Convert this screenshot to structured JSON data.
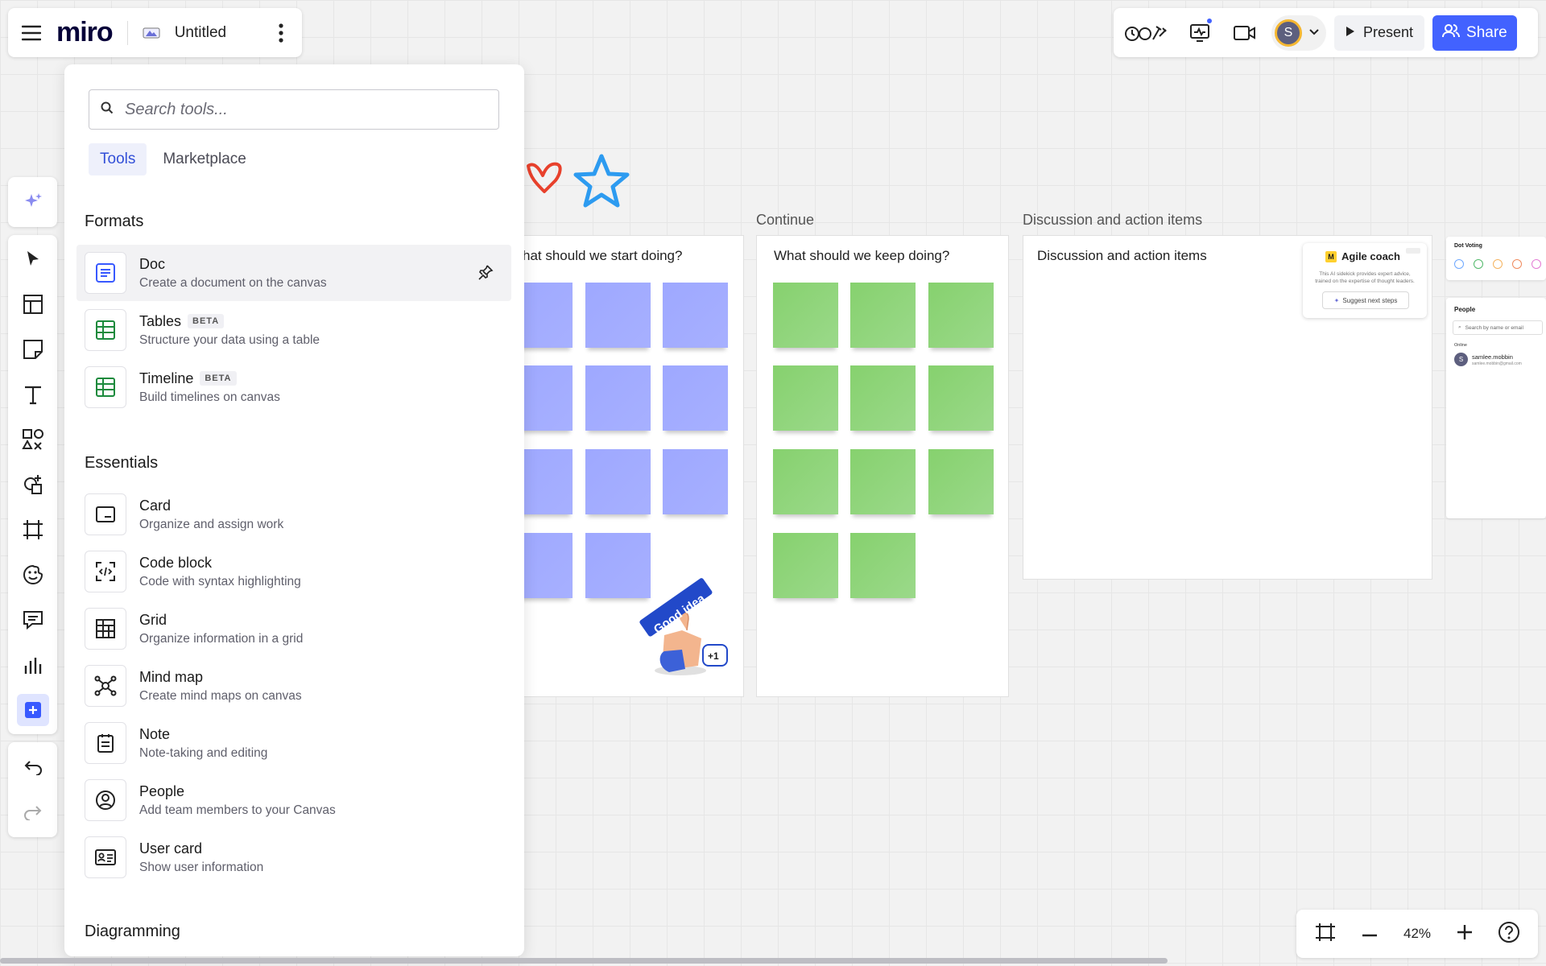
{
  "topbar": {
    "logo": "miro",
    "board_title": "Untitled",
    "present_label": "Present",
    "share_label": "Share",
    "avatar_initial": "S"
  },
  "tools_panel": {
    "search_placeholder": "Search tools...",
    "tabs": [
      {
        "label": "Tools",
        "active": true
      },
      {
        "label": "Marketplace",
        "active": false
      }
    ],
    "sections": [
      {
        "title": "Formats",
        "items": [
          {
            "name": "Doc",
            "desc": "Create a document on the canvas",
            "beta": false,
            "icon": "doc-icon"
          },
          {
            "name": "Tables",
            "desc": "Structure your data using a table",
            "beta": true,
            "icon": "table-icon"
          },
          {
            "name": "Timeline",
            "desc": "Build timelines on canvas",
            "beta": true,
            "icon": "timeline-icon"
          }
        ]
      },
      {
        "title": "Essentials",
        "items": [
          {
            "name": "Card",
            "desc": "Organize and assign work",
            "icon": "card-icon"
          },
          {
            "name": "Code block",
            "desc": "Code with syntax highlighting",
            "icon": "code-icon"
          },
          {
            "name": "Grid",
            "desc": "Organize information in a grid",
            "icon": "grid-icon"
          },
          {
            "name": "Mind map",
            "desc": "Create mind maps on canvas",
            "icon": "mindmap-icon"
          },
          {
            "name": "Note",
            "desc": "Note-taking and editing",
            "icon": "note-icon"
          },
          {
            "name": "People",
            "desc": "Add team members to your Canvas",
            "icon": "people-icon"
          },
          {
            "name": "User card",
            "desc": "Show user information",
            "icon": "user-card-icon"
          }
        ]
      },
      {
        "title": "Diagramming",
        "items": []
      }
    ],
    "beta_label": "BETA"
  },
  "canvas": {
    "frames": [
      {
        "label": "",
        "inner_title": "hat should we start doing?"
      },
      {
        "label": "Continue",
        "inner_title": "What should we keep doing?"
      },
      {
        "label": "Discussion and action items",
        "inner_title": "Discussion and action items"
      }
    ],
    "sticker_text": "Good idea",
    "sticker_badge": "+1",
    "agile_coach": {
      "title": "Agile coach",
      "desc": "This AI sidekick provides expert advice, trained on the expertise of thought leaders.",
      "button": "Suggest next steps"
    },
    "dot_voting": {
      "title": "Dot Voting",
      "colors": [
        "#6ea8ff",
        "#52b96a",
        "#f5b35f",
        "#f08a5d",
        "#e37ad4"
      ]
    },
    "people_panel": {
      "title": "People",
      "search_placeholder": "Search by name or email",
      "online_label": "Online",
      "user_name": "samlee.mobbin",
      "user_email": "samlee.mobbin@gmail.com",
      "user_initial": "S"
    }
  },
  "zoom": {
    "level": "42%"
  },
  "colors": {
    "accent": "#4262ff",
    "sticky_blue": "#a3acff",
    "sticky_green": "#92d47d"
  }
}
